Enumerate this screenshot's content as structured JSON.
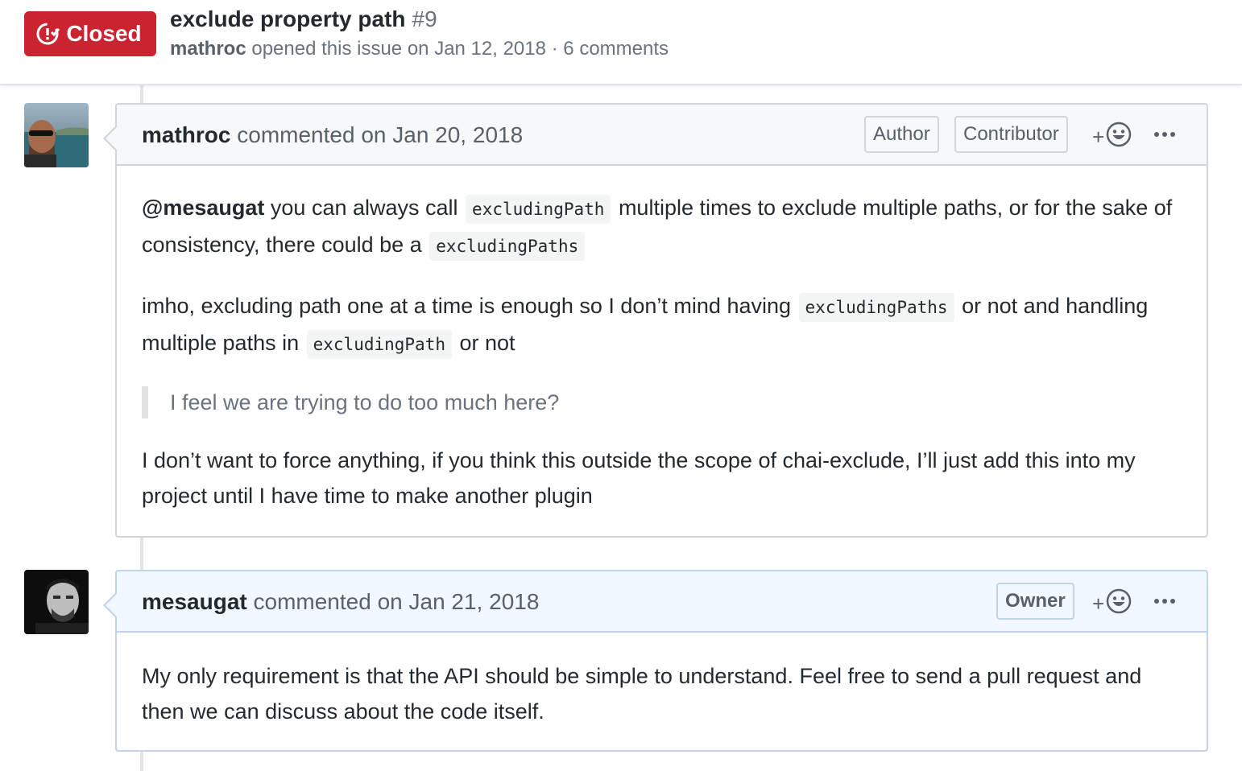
{
  "issue": {
    "state": "Closed",
    "title": "exclude property path",
    "number": "#9",
    "author": "mathroc",
    "meta_rest": "opened this issue on Jan 12, 2018 · 6 comments"
  },
  "colors": {
    "closed_red": "#cb2431",
    "owner_header_bg": "#f1f8ff",
    "header_bg": "#f6f8fa"
  },
  "comments": [
    {
      "author": "mathroc",
      "action": "commented on Jan 20, 2018",
      "labels": [
        "Author",
        "Contributor"
      ],
      "reaction_plus": "+",
      "p1_mention": "@mesaugat",
      "p1_a": "you can always call",
      "p1_code1": "excludingPath",
      "p1_b": "multiple times to exclude multiple paths, or for the sake of consistency, there could be a",
      "p1_code2": "excludingPaths",
      "p2_a": "imho, excluding path one at a time is enough so I don’t mind having",
      "p2_code1": "excludingPaths",
      "p2_b": "or not and handling multiple paths in",
      "p2_code2": "excludingPath",
      "p2_c": "or not",
      "quote": "I feel we are trying to do too much here?",
      "p3": "I don’t want to force anything, if you think this outside the scope of chai-exclude, I’ll just add this into my project until I have time to make another plugin"
    },
    {
      "author": "mesaugat",
      "action": "commented on Jan 21, 2018",
      "labels": [
        "Owner"
      ],
      "reaction_plus": "+",
      "p1": "My only requirement is that the API should be simple to understand. Feel free to send a pull request and then we can discuss about the code itself."
    }
  ],
  "icons": {
    "state": "issue-closed-icon",
    "reaction": "smiley-icon",
    "more": "kebab-horizontal-icon"
  }
}
